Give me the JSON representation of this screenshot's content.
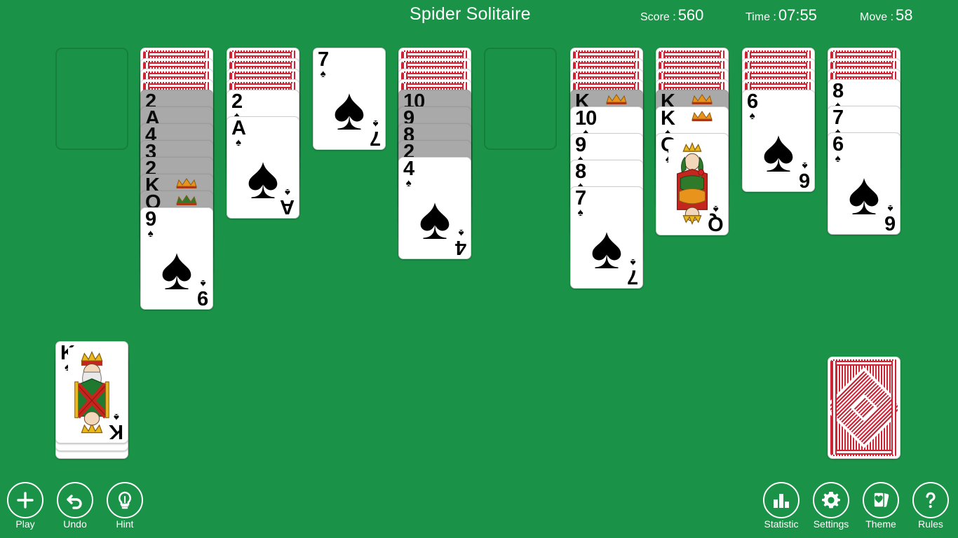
{
  "header": {
    "title": "Spider Solitaire",
    "score_label": "Score :",
    "score_value": "560",
    "time_label": "Time :",
    "time_value": "07:55",
    "move_label": "Move :",
    "move_value": "58"
  },
  "theme": {
    "felt_green": "#1a9245",
    "card_white": "#ffffff",
    "dim_grey": "#a9a9a9",
    "card_back_red": "#cf2233",
    "suit_black": "#000000"
  },
  "board": {
    "suit": "spade",
    "suit_glyph": "♠",
    "columns": [
      {
        "index": 1,
        "empty": true,
        "facedown": 0,
        "cards": []
      },
      {
        "index": 2,
        "empty": false,
        "facedown": 4,
        "cards": [
          {
            "rank": "2",
            "state": "dim"
          },
          {
            "rank": "A",
            "state": "dim"
          },
          {
            "rank": "4",
            "state": "dim"
          },
          {
            "rank": "3",
            "state": "dim"
          },
          {
            "rank": "2",
            "state": "dim"
          },
          {
            "rank": "K",
            "state": "dim",
            "court": "king"
          },
          {
            "rank": "Q",
            "state": "dim",
            "court": "queen"
          },
          {
            "rank": "9",
            "state": "up"
          }
        ]
      },
      {
        "index": 3,
        "empty": false,
        "facedown": 4,
        "cards": [
          {
            "rank": "2",
            "state": "up"
          },
          {
            "rank": "A",
            "state": "up"
          }
        ]
      },
      {
        "index": 4,
        "empty": false,
        "facedown": 0,
        "cards": [
          {
            "rank": "7",
            "state": "up"
          }
        ]
      },
      {
        "index": 5,
        "empty": false,
        "facedown": 4,
        "cards": [
          {
            "rank": "10",
            "state": "dim"
          },
          {
            "rank": "9",
            "state": "dim"
          },
          {
            "rank": "8",
            "state": "dim"
          },
          {
            "rank": "2",
            "state": "dim"
          },
          {
            "rank": "4",
            "state": "up"
          }
        ]
      },
      {
        "index": 6,
        "empty": true,
        "facedown": 0,
        "cards": []
      },
      {
        "index": 7,
        "empty": false,
        "facedown": 4,
        "cards": [
          {
            "rank": "K",
            "state": "dim",
            "court": "king"
          },
          {
            "rank": "10",
            "state": "up"
          },
          {
            "rank": "9",
            "state": "up"
          },
          {
            "rank": "8",
            "state": "up"
          },
          {
            "rank": "7",
            "state": "up"
          }
        ]
      },
      {
        "index": 8,
        "empty": false,
        "facedown": 4,
        "cards": [
          {
            "rank": "K",
            "state": "dim",
            "court": "king"
          },
          {
            "rank": "K",
            "state": "up",
            "court": "king"
          },
          {
            "rank": "Q",
            "state": "up",
            "court": "queen"
          }
        ]
      },
      {
        "index": 9,
        "empty": false,
        "facedown": 4,
        "cards": [
          {
            "rank": "6",
            "state": "up"
          }
        ]
      },
      {
        "index": 10,
        "empty": false,
        "facedown": 3,
        "cards": [
          {
            "rank": "8",
            "state": "up"
          },
          {
            "rank": "7",
            "state": "up"
          },
          {
            "rank": "6",
            "state": "up"
          }
        ]
      }
    ]
  },
  "foundation": {
    "rank": "K",
    "suit_glyph": "♠",
    "court": "king",
    "stacked_edges": 2
  },
  "stock": {
    "face": "back",
    "label": "stock-pile"
  },
  "toolbar_left": [
    {
      "id": "play",
      "label": "Play",
      "icon": "plus-icon"
    },
    {
      "id": "undo",
      "label": "Undo",
      "icon": "undo-arrow-icon"
    },
    {
      "id": "hint",
      "label": "Hint",
      "icon": "lightbulb-icon"
    }
  ],
  "toolbar_right": [
    {
      "id": "statistic",
      "label": "Statistic",
      "icon": "bar-chart-icon"
    },
    {
      "id": "settings",
      "label": "Settings",
      "icon": "gear-icon"
    },
    {
      "id": "theme",
      "label": "Theme",
      "icon": "cards-heart-icon"
    },
    {
      "id": "rules",
      "label": "Rules",
      "icon": "question-mark-icon"
    }
  ]
}
